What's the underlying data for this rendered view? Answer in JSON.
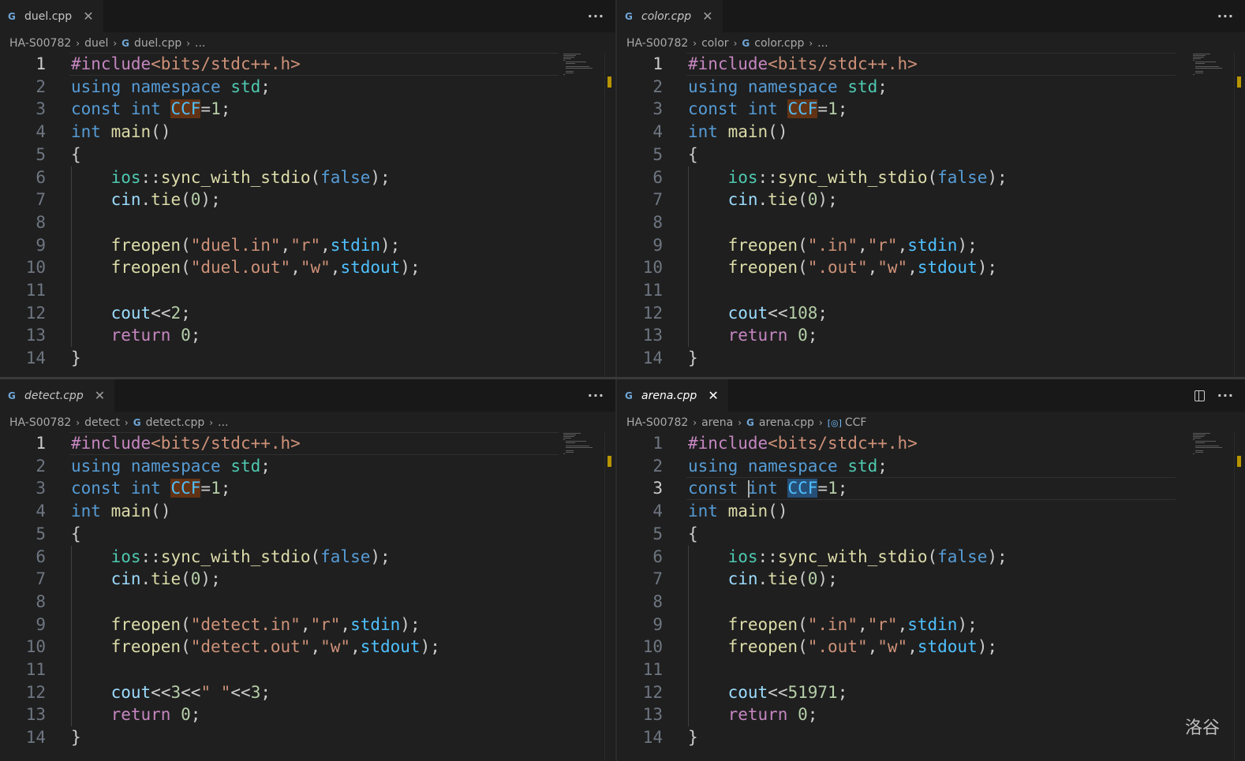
{
  "panes": [
    {
      "id": "tl",
      "tab": {
        "label": "duel.cpp",
        "italic": false,
        "active": false
      },
      "breadcrumb": [
        "HA-S00782",
        "duel",
        "duel.cpp",
        "..."
      ],
      "breadcrumb_symbol": null,
      "actions": [
        "..."
      ],
      "active_line": 1,
      "ccf_highlight": "rename",
      "lines": [
        "#include<bits/stdc++.h>",
        "using namespace std;",
        "const int CCF=1;",
        "int main()",
        "{",
        "    ios::sync_with_stdio(false);",
        "    cin.tie(0);",
        "",
        "    freopen(\"duel.in\",\"r\",stdin);",
        "    freopen(\"duel.out\",\"w\",stdout);",
        "",
        "    cout<<2;",
        "    return 0;",
        "}"
      ]
    },
    {
      "id": "tr",
      "tab": {
        "label": "color.cpp",
        "italic": true,
        "active": false
      },
      "breadcrumb": [
        "HA-S00782",
        "color",
        "color.cpp",
        "..."
      ],
      "breadcrumb_symbol": null,
      "actions": [
        "..."
      ],
      "active_line": 1,
      "ccf_highlight": "rename",
      "lines": [
        "#include<bits/stdc++.h>",
        "using namespace std;",
        "const int CCF=1;",
        "int main()",
        "{",
        "    ios::sync_with_stdio(false);",
        "    cin.tie(0);",
        "",
        "    freopen(\".in\",\"r\",stdin);",
        "    freopen(\".out\",\"w\",stdout);",
        "",
        "    cout<<108;",
        "    return 0;",
        "}"
      ]
    },
    {
      "id": "bl",
      "tab": {
        "label": "detect.cpp",
        "italic": true,
        "active": false
      },
      "breadcrumb": [
        "HA-S00782",
        "detect",
        "detect.cpp",
        "..."
      ],
      "breadcrumb_symbol": null,
      "actions": [
        "..."
      ],
      "active_line": 1,
      "ccf_highlight": "rename",
      "lines": [
        "#include<bits/stdc++.h>",
        "using namespace std;",
        "const int CCF=1;",
        "int main()",
        "{",
        "    ios::sync_with_stdio(false);",
        "    cin.tie(0);",
        "",
        "    freopen(\"detect.in\",\"r\",stdin);",
        "    freopen(\"detect.out\",\"w\",stdout);",
        "",
        "    cout<<3<<\" \"<<3;",
        "    return 0;",
        "}"
      ]
    },
    {
      "id": "br",
      "tab": {
        "label": "arena.cpp",
        "italic": true,
        "active": true
      },
      "breadcrumb": [
        "HA-S00782",
        "arena",
        "arena.cpp",
        "CCF"
      ],
      "breadcrumb_symbol": "CCF",
      "actions": [
        "split",
        "..."
      ],
      "active_line": 3,
      "ccf_highlight": "selected",
      "lines": [
        "#include<bits/stdc++.h>",
        "using namespace std;",
        "const int CCF=1;",
        "int main()",
        "{",
        "    ios::sync_with_stdio(false);",
        "    cin.tie(0);",
        "",
        "    freopen(\".in\",\"r\",stdin);",
        "    freopen(\".out\",\"w\",stdout);",
        "",
        "    cout<<51971;",
        "    return 0;",
        "}"
      ]
    }
  ],
  "watermark": "洛谷",
  "colors": {
    "background": "#1f1f1f",
    "keyword": "#569cd6",
    "control": "#c586c0",
    "string": "#ce9178",
    "number": "#b5cea8",
    "function": "#dcdcaa",
    "namespace": "#4ec9b0",
    "variable": "#9cdcfe"
  }
}
